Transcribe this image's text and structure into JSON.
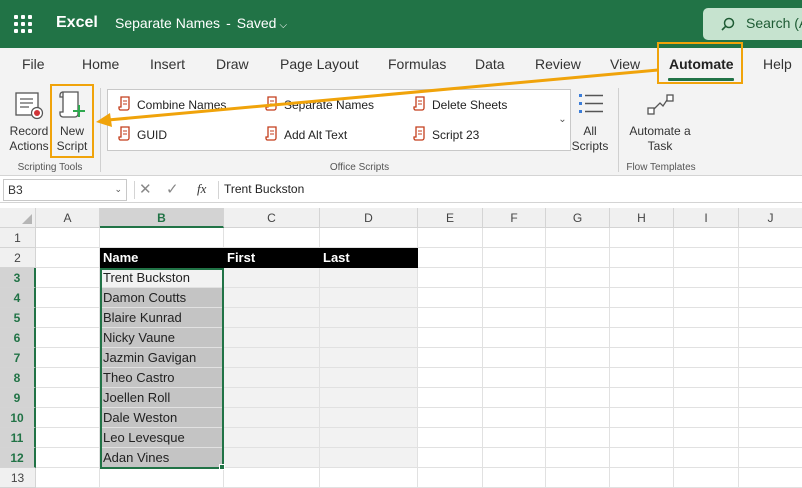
{
  "titlebar": {
    "app": "Excel",
    "document": "Separate Names",
    "separator": "-",
    "status": "Saved",
    "search": "Search (A"
  },
  "tabs": [
    "File",
    "Home",
    "Insert",
    "Draw",
    "Page Layout",
    "Formulas",
    "Data",
    "Review",
    "View",
    "Automate",
    "Help"
  ],
  "active_tab": "Automate",
  "ribbon": {
    "record_line1": "Record",
    "record_line2": "Actions",
    "new_line1": "New",
    "new_line2": "Script",
    "scripting_tools": "Scripting Tools",
    "scripts": [
      "Combine Names",
      "Separate Names",
      "Delete Sheets",
      "GUID",
      "Add Alt Text",
      "Script 23"
    ],
    "office_scripts": "Office Scripts",
    "all_line1": "All",
    "all_line2": "Scripts",
    "automate_line1": "Automate a",
    "automate_line2": "Task",
    "flow_templates": "Flow Templates"
  },
  "formula_bar": {
    "name_box": "B3",
    "content": "Trent Buckston",
    "fx": "fx"
  },
  "columns": [
    "A",
    "B",
    "C",
    "D",
    "E",
    "F",
    "G",
    "H",
    "I",
    "J"
  ],
  "rows": [
    "1",
    "2",
    "3",
    "4",
    "5",
    "6",
    "7",
    "8",
    "9",
    "10",
    "11",
    "12",
    "13"
  ],
  "table": {
    "headers": [
      "Name",
      "First",
      "Last"
    ],
    "names": [
      "Trent Buckston",
      "Damon Coutts",
      "Blaire Kunrad",
      "Nicky Vaune",
      "Jazmin Gavigan",
      "Theo Castro",
      "Joellen Roll",
      "Dale Weston",
      "Leo Levesque",
      "Adan Vines"
    ]
  },
  "colors": {
    "brand": "#217346",
    "callout": "#f0a30a",
    "script_icon": "#c43e1c"
  },
  "icons": {
    "waffle": "waffle-icon",
    "record": "record-actions-icon",
    "new_script": "new-script-icon",
    "script": "script-icon",
    "all_scripts": "all-scripts-icon",
    "automate": "flow-icon"
  }
}
